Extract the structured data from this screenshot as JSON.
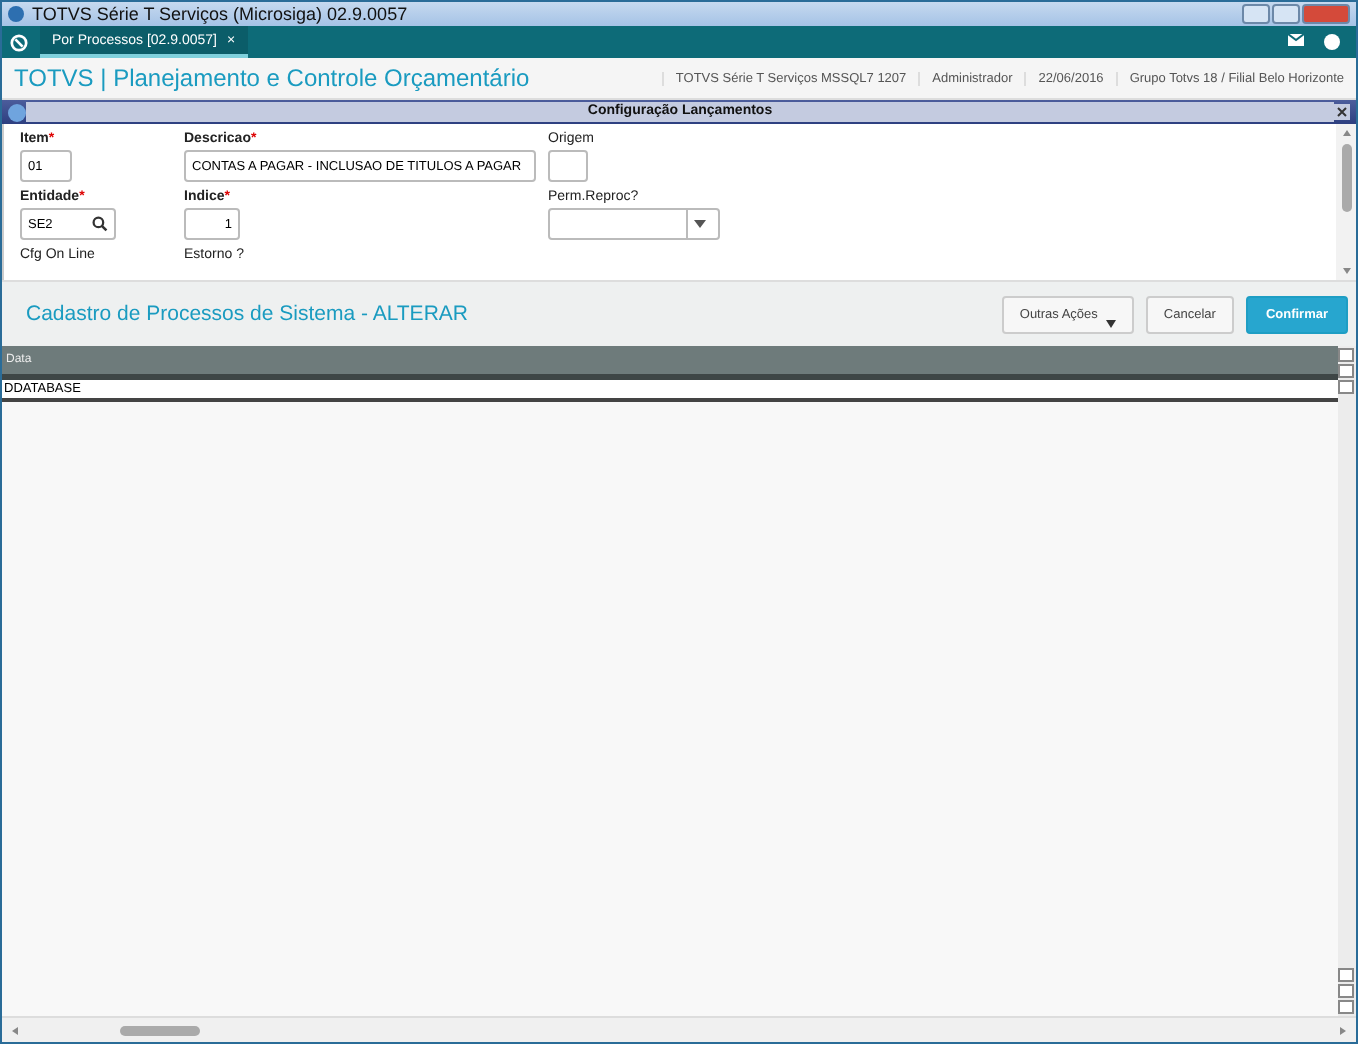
{
  "window": {
    "title": "TOTVS Série T Serviços (Microsiga) 02.9.0057"
  },
  "tabs": [
    {
      "label": "Por Processos [02.9.0057]",
      "selected": true,
      "close": "×"
    }
  ],
  "header": {
    "title": "TOTVS | Planejamento e Controle Orçamentário",
    "info": [
      "TOTVS Série T Serviços MSSQL7 1207",
      "Administrador",
      "22/06/2016",
      "Grupo Totvs 18 / Filial Belo Horizonte"
    ]
  },
  "dialog": {
    "title": "Configuração Lançamentos"
  },
  "form": {
    "rows": [
      [
        {
          "label": "Item",
          "required_mark": "*",
          "value": "01",
          "kind": "text"
        },
        {
          "label": "Descricao",
          "required_mark": "*",
          "value": "CONTAS A PAGAR - INCLUSAO DE TITULOS A PAGAR",
          "kind": "text"
        },
        {
          "label": "Origem",
          "kind": "text"
        }
      ],
      [
        {
          "label": "Entidade",
          "required_mark": "*",
          "value": "SE2",
          "kind": "search"
        },
        {
          "label": "Indice",
          "required_mark": "*",
          "value": "1",
          "kind": "number"
        },
        {
          "label": "Perm.Reproc?",
          "kind": "select"
        }
      ],
      [
        {
          "label": "Cfg On Line",
          "kind": "label"
        },
        {
          "label": "Estorno ?",
          "kind": "label"
        }
      ]
    ]
  },
  "action_bar": {
    "title": "Cadastro de Processos de Sistema - ALTERAR",
    "buttons": [
      {
        "label": "Outras Ações",
        "kind": "menu"
      },
      {
        "label": "Cancelar",
        "kind": "plain"
      },
      {
        "label": "Confirmar",
        "kind": "primary"
      }
    ]
  },
  "table": {
    "columns": [
      "Data"
    ],
    "rows": [
      {
        "cells": [
          "DDATABASE"
        ],
        "selected": true
      }
    ]
  }
}
